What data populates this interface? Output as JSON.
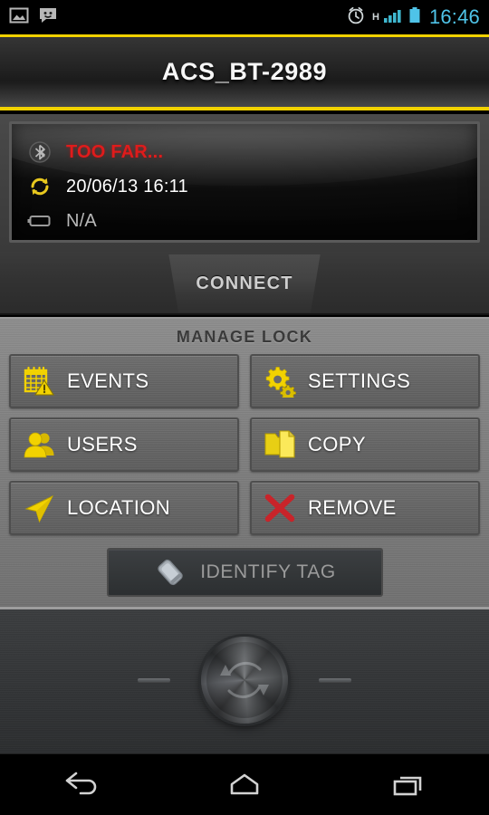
{
  "status_bar": {
    "left_icons": [
      {
        "name": "gallery-icon",
        "label": "Gallery"
      },
      {
        "name": "messaging-icon",
        "label": "Messaging"
      }
    ],
    "right_icons": [
      {
        "name": "alarm-clock-icon",
        "label": "Alarm set"
      },
      {
        "name": "signal-bars-icon",
        "label": "Mobile signal"
      },
      {
        "name": "battery-icon",
        "label": "Battery"
      }
    ],
    "network_type": "H",
    "clock": "16:46",
    "clock_color": "#4fc3e8"
  },
  "header": {
    "title": "ACS_BT-2989",
    "accent_color": "#f2d200"
  },
  "status_panel": {
    "rows": [
      {
        "icon": "bluetooth-icon",
        "text": "TOO FAR...",
        "color": "#e01b1b",
        "name": "bluetooth-status"
      },
      {
        "icon": "sync-icon",
        "text": "20/06/13 16:11",
        "color": "#ffffff",
        "name": "last-sync-status"
      },
      {
        "icon": "battery-icon",
        "text": "N/A",
        "color": "#b9b9b9",
        "name": "battery-status"
      }
    ]
  },
  "connect": {
    "label": "CONNECT"
  },
  "manage": {
    "section_title": "MANAGE LOCK",
    "buttons": [
      {
        "label": "EVENTS",
        "icon": "calendar-warning-icon",
        "name": "events-button"
      },
      {
        "label": "SETTINGS",
        "icon": "gears-icon",
        "name": "settings-button"
      },
      {
        "label": "USERS",
        "icon": "users-icon",
        "name": "users-button"
      },
      {
        "label": "COPY",
        "icon": "copy-documents-icon",
        "name": "copy-button"
      },
      {
        "label": "LOCATION",
        "icon": "navigation-arrow-icon",
        "name": "location-button"
      },
      {
        "label": "REMOVE",
        "icon": "red-x-icon",
        "name": "remove-button"
      }
    ],
    "icon_color": "#f2d200",
    "remove_icon_color": "#c8242a"
  },
  "identify": {
    "label": "IDENTIFY TAG",
    "icon": "tag-cylinder-icon",
    "enabled": false
  },
  "knob": {
    "name": "rotary-knob",
    "left_dash": "-",
    "right_dash": "-"
  },
  "nav_bar": {
    "buttons": [
      {
        "name": "nav-back-button",
        "label": "Back"
      },
      {
        "name": "nav-home-button",
        "label": "Home"
      },
      {
        "name": "nav-recents-button",
        "label": "Recents"
      }
    ]
  }
}
